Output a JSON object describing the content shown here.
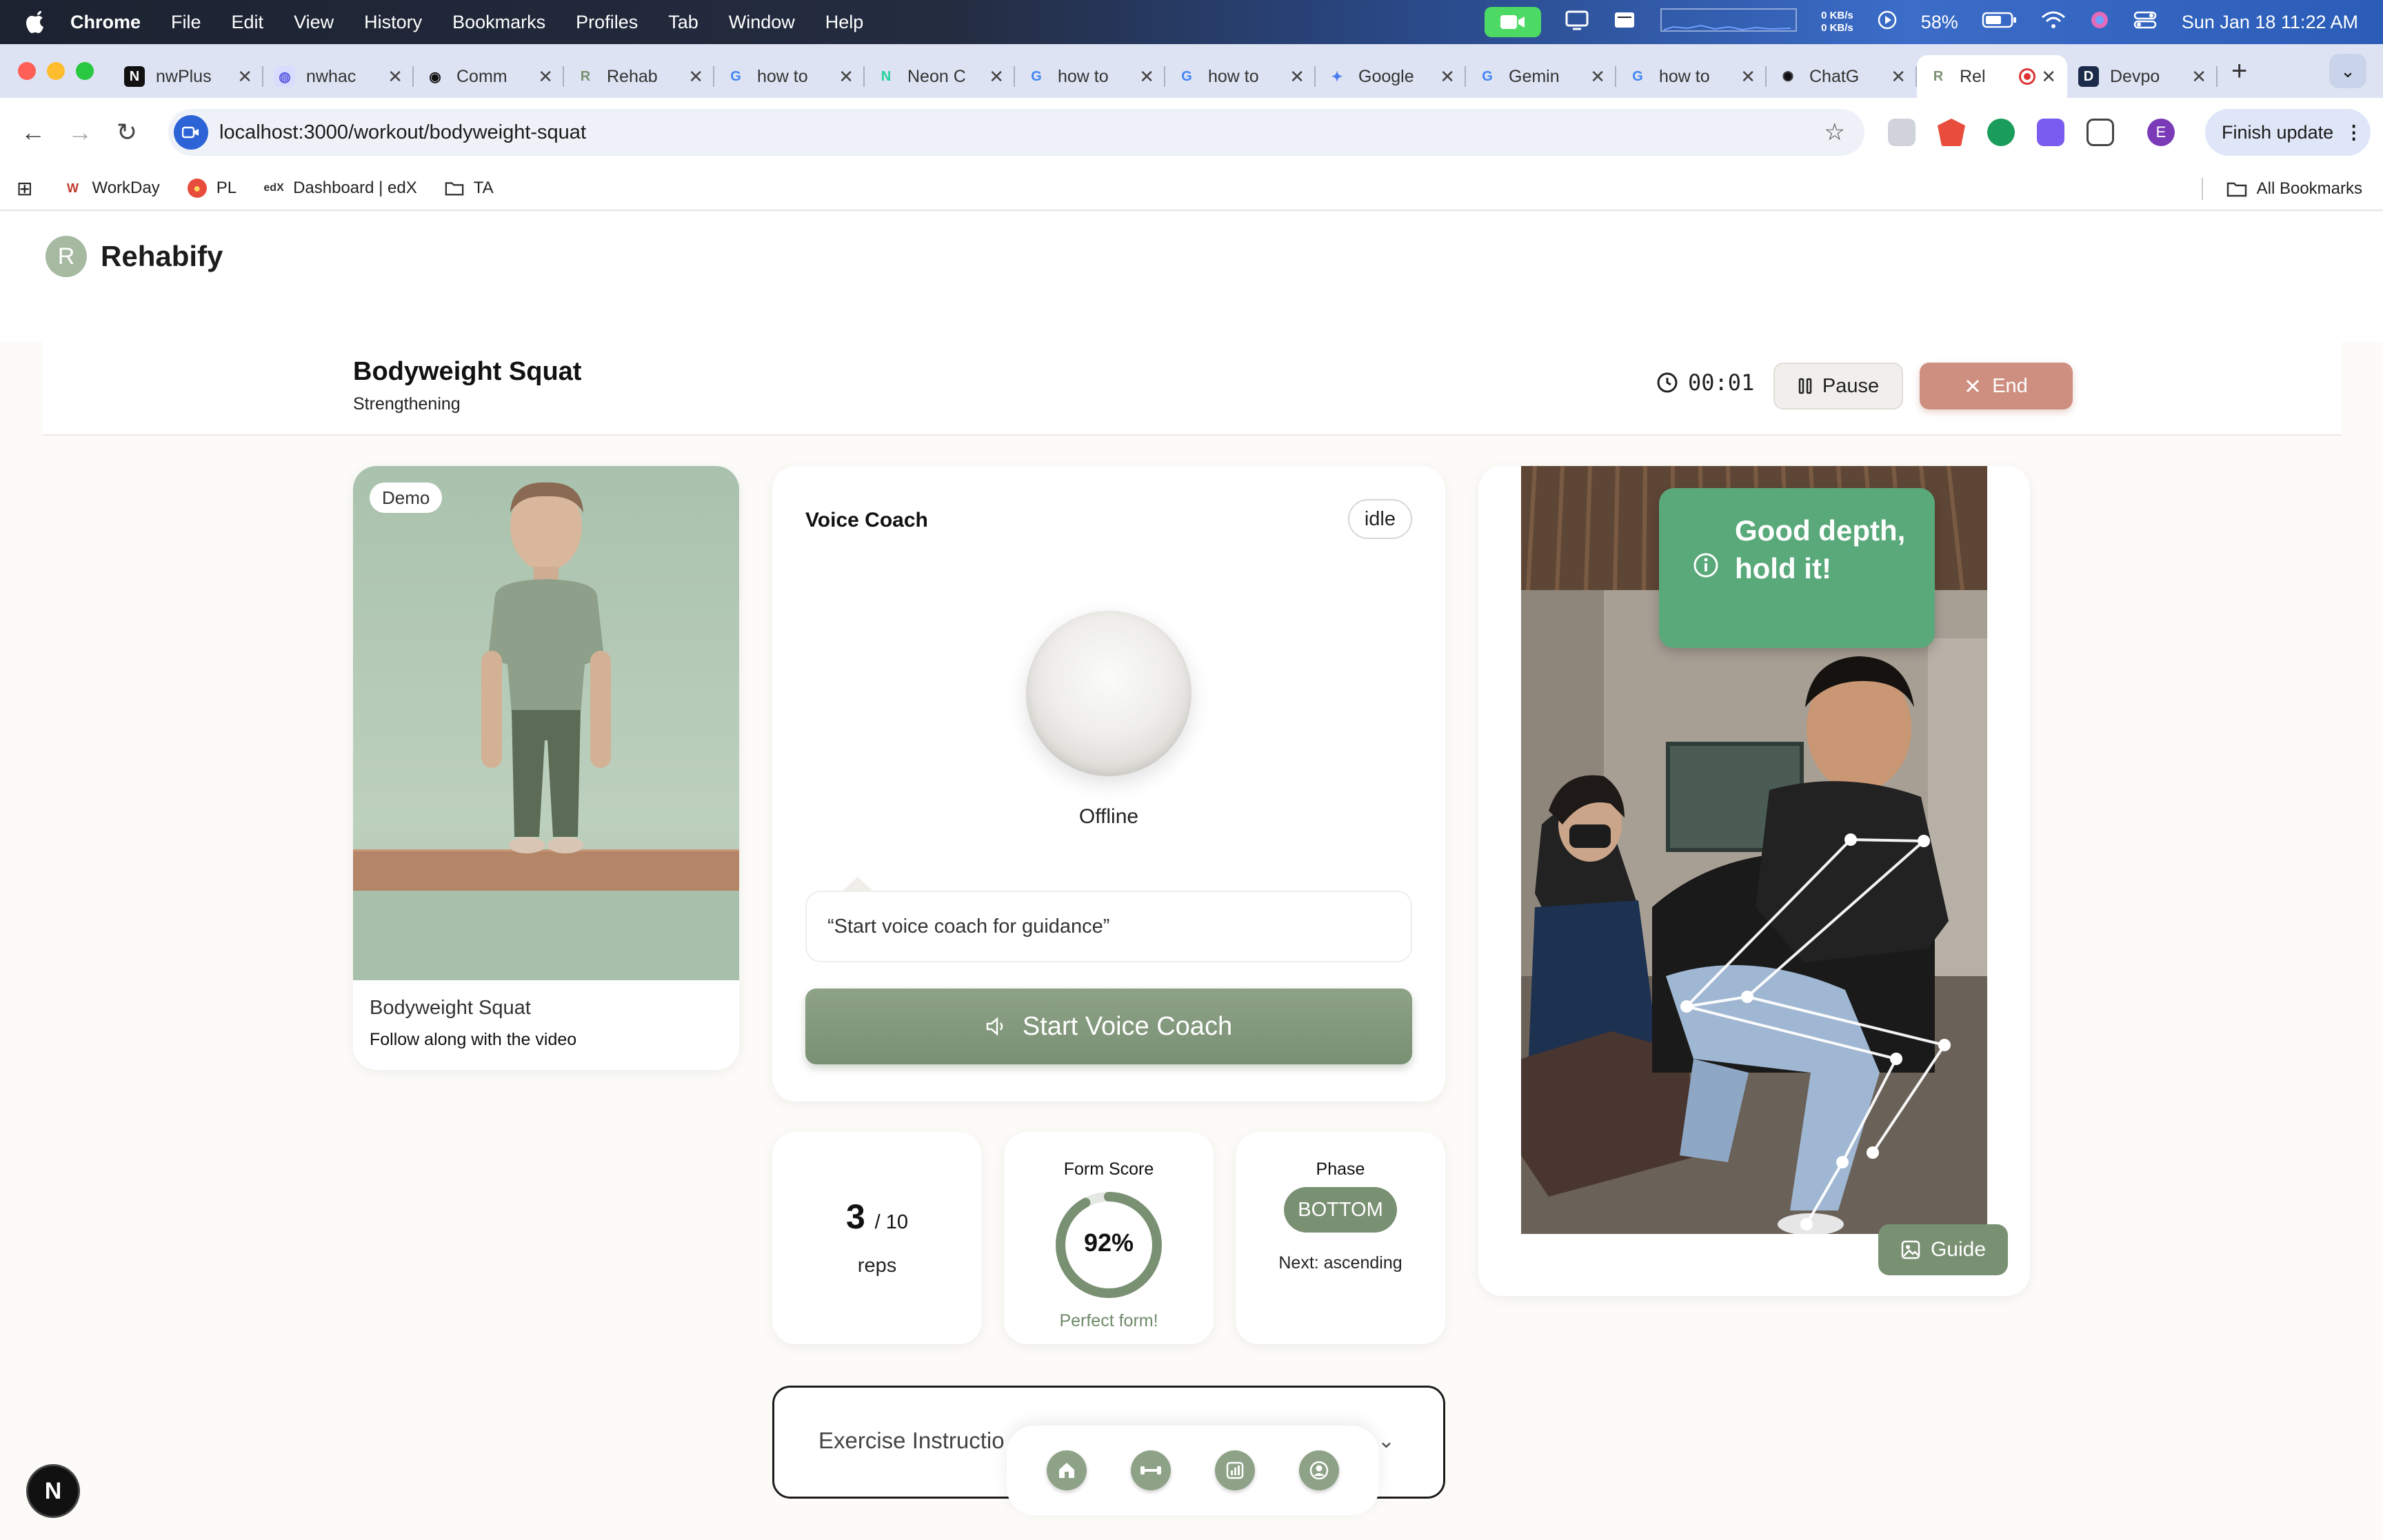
{
  "menubar": {
    "app": "Chrome",
    "items": [
      "File",
      "Edit",
      "View",
      "History",
      "Bookmarks",
      "Profiles",
      "Tab",
      "Window",
      "Help"
    ],
    "net_up": "0 KB/s",
    "net_down": "0 KB/s",
    "battery": "58%",
    "datetime": "Sun Jan 18  11:22 AM"
  },
  "tabs": [
    {
      "title": "nwPlus",
      "fav": "N",
      "fav_bg": "#111111",
      "fav_fg": "#ffffff"
    },
    {
      "title": "nwhac",
      "fav": "◍",
      "fav_bg": "#d8dcff",
      "fav_fg": "#5b5be0"
    },
    {
      "title": "Comm",
      "fav": "◉",
      "fav_bg": "#dde3f2",
      "fav_fg": "#111111"
    },
    {
      "title": "Rehab",
      "fav": "R",
      "fav_bg": "#dde3f2",
      "fav_fg": "#7a9073"
    },
    {
      "title": "how to",
      "fav": "G",
      "fav_bg": "#dde3f2",
      "fav_fg": "#4285f4"
    },
    {
      "title": "Neon C",
      "fav": "N",
      "fav_bg": "#dde3f2",
      "fav_fg": "#1fd39a"
    },
    {
      "title": "how to",
      "fav": "G",
      "fav_bg": "#dde3f2",
      "fav_fg": "#4285f4"
    },
    {
      "title": "how to",
      "fav": "G",
      "fav_bg": "#dde3f2",
      "fav_fg": "#4285f4"
    },
    {
      "title": "Google",
      "fav": "✦",
      "fav_bg": "#dde3f2",
      "fav_fg": "#4a7cf0"
    },
    {
      "title": "Gemin",
      "fav": "G",
      "fav_bg": "#dde3f2",
      "fav_fg": "#4285f4"
    },
    {
      "title": "how to",
      "fav": "G",
      "fav_bg": "#dde3f2",
      "fav_fg": "#4285f4"
    },
    {
      "title": "ChatG",
      "fav": "✺",
      "fav_bg": "#dde3f2",
      "fav_fg": "#111111"
    },
    {
      "title": "Rel",
      "fav": "R",
      "fav_bg": "#ffffff",
      "fav_fg": "#7a9073",
      "active": true
    },
    {
      "title": "Devpo",
      "fav": "D",
      "fav_bg": "#1c2b4a",
      "fav_fg": "#ffffff"
    }
  ],
  "toolbar": {
    "url": "localhost:3000/workout/bodyweight-squat",
    "finish_update": "Finish update",
    "profile_initial": "E"
  },
  "bookmarks": {
    "items": [
      {
        "label": "WorkDay",
        "icon": "W",
        "color": "#c0392b"
      },
      {
        "label": "PL",
        "icon": "●",
        "color": "#e74c3c"
      },
      {
        "label": "Dashboard | edX",
        "icon": "edX",
        "color": "#333333"
      },
      {
        "label": "TA",
        "icon": "folder",
        "color": "#333333"
      }
    ],
    "all": "All Bookmarks"
  },
  "app": {
    "logo_letter": "R",
    "name": "Rehabify",
    "accent": "#7a9073",
    "danger": "#cf8f80"
  },
  "workout": {
    "title": "Bodyweight Squat",
    "category": "Strengthening",
    "timer": "00:01",
    "pause_label": "Pause",
    "end_label": "End"
  },
  "demo": {
    "badge": "Demo",
    "title": "Bodyweight Squat",
    "subtitle": "Follow along with the video"
  },
  "voice_coach": {
    "title": "Voice Coach",
    "status": "idle",
    "orb_label": "Offline",
    "message": "“Start voice coach for guidance”",
    "button": "Start Voice Coach"
  },
  "stats": {
    "reps": "3",
    "reps_target": "/ 10",
    "reps_label": "reps",
    "form_title": "Form Score",
    "form_value": "92%",
    "form_fraction": 0.92,
    "form_caption": "Perfect form!",
    "phase_title": "Phase",
    "phase_value": "BOTTOM",
    "phase_next": "Next: ascending"
  },
  "camera": {
    "feedback": "Good depth, hold it!",
    "guide_label": "Guide"
  },
  "instructions": {
    "label": "Exercise Instructions"
  },
  "dock": [
    "home-icon",
    "dumbbell-icon",
    "stats-icon",
    "profile-icon"
  ],
  "dev_badge": "N"
}
